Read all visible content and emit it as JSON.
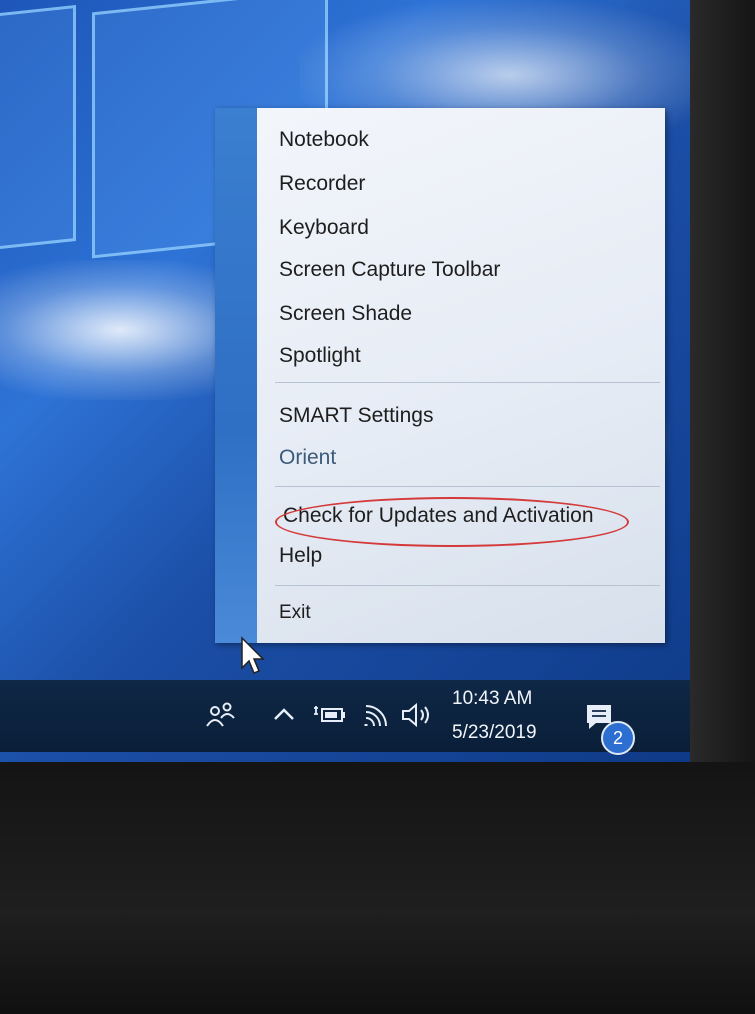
{
  "menu": {
    "items": [
      {
        "label": "Notebook"
      },
      {
        "label": "Recorder"
      },
      {
        "label": "Keyboard"
      },
      {
        "label": "Screen Capture Toolbar"
      },
      {
        "label": "Screen Shade"
      },
      {
        "label": "Spotlight"
      },
      {
        "label": "SMART Settings"
      },
      {
        "label": "Orient"
      },
      {
        "label": "Check for Updates and Activation"
      },
      {
        "label": "Help"
      },
      {
        "label": "Exit"
      }
    ],
    "highlight_color": "#d43a3a"
  },
  "taskbar": {
    "time": "10:43 AM",
    "date": "5/23/2019",
    "notification_count": "2",
    "icons": [
      "people-icon",
      "show-hidden-icons-chevron",
      "battery-icon",
      "wifi-icon",
      "volume-icon",
      "action-center-icon"
    ]
  },
  "colors": {
    "desktop": "#1d56b8",
    "taskbar": "#0f2846",
    "menu_strip": "#3a7fd0"
  }
}
